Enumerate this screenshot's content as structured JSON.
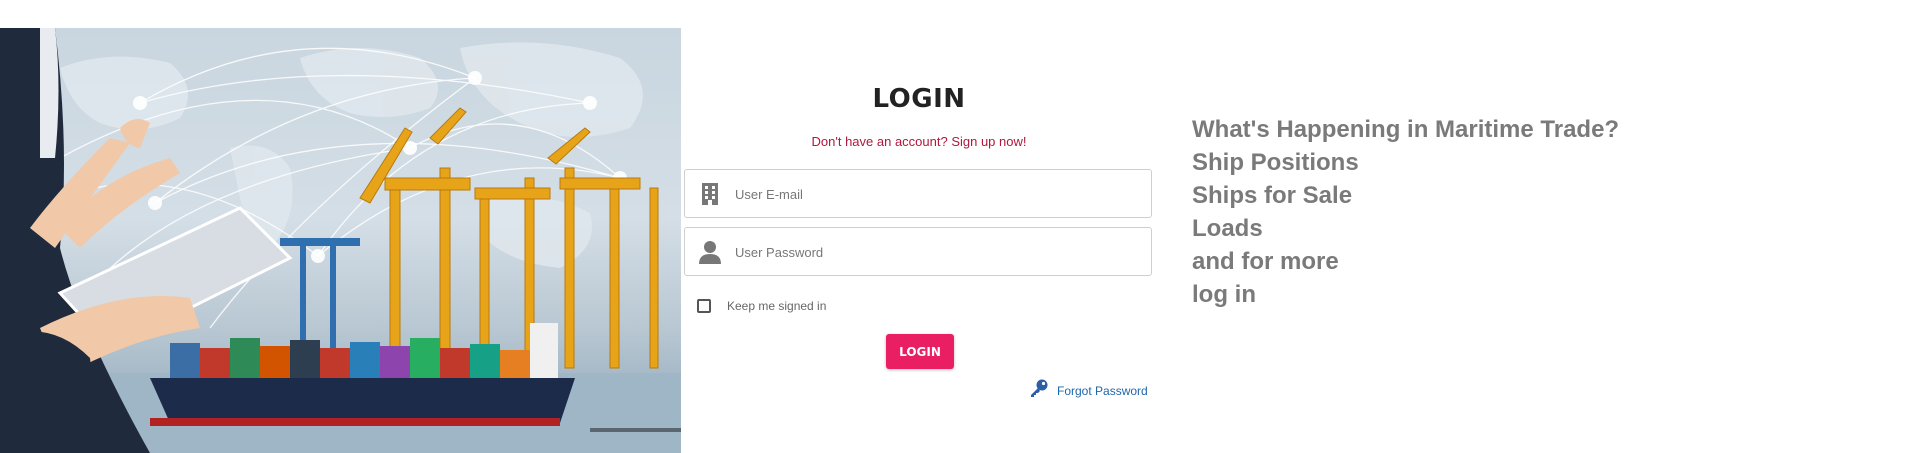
{
  "login": {
    "title": "LOGIN",
    "signup_text": "Don't have an account? Sign up now!",
    "email": {
      "placeholder": "User E-mail",
      "value": "",
      "icon": "building-icon"
    },
    "password": {
      "placeholder": "User Password",
      "value": "",
      "icon": "user-icon"
    },
    "remember": {
      "label": "Keep me signed in",
      "checked": false
    },
    "submit_label": "LOGIN",
    "forgot": {
      "label": "Forgot Password",
      "icon": "key-icon"
    }
  },
  "info": {
    "lines": [
      "What's Happening in Maritime Trade?",
      "Ship Positions",
      "Ships for Sale",
      "Loads",
      "and for more",
      "log in"
    ]
  },
  "colors": {
    "accent": "#e91e63",
    "link_red": "#b0183c",
    "link_blue": "#2266aa",
    "info_text": "#7a7a7a"
  }
}
